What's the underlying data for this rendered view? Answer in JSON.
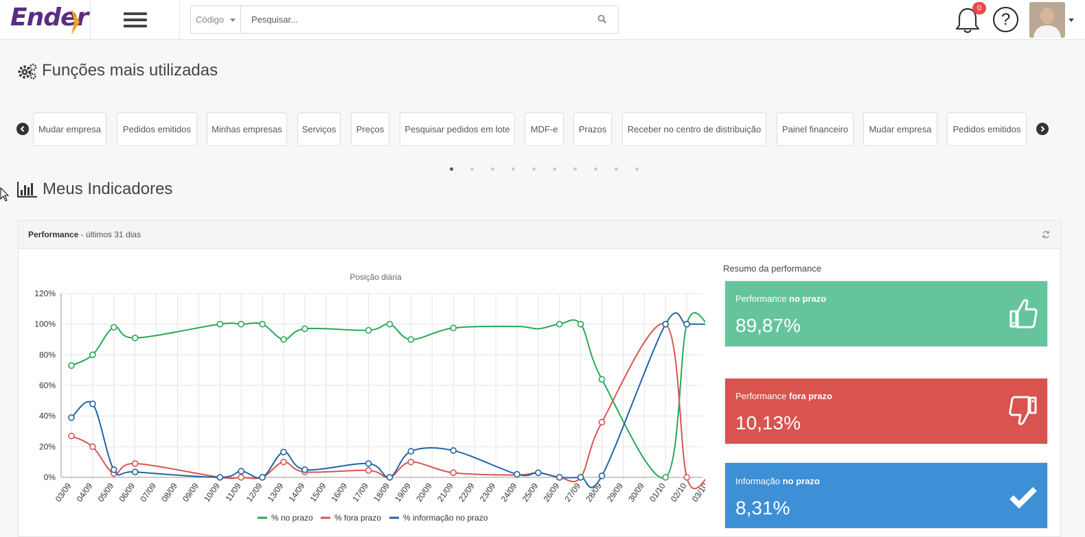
{
  "header": {
    "logo_text": "Ender",
    "search_select": "Código",
    "search_placeholder": "Pesquisar...",
    "notification_count": "0",
    "help_label": "?"
  },
  "funcoes": {
    "title": "Funções mais utilizadas",
    "items": [
      "Mudar empresa",
      "Pedidos emitidos",
      "Minhas empresas",
      "Serviços",
      "Preços",
      "Pesquisar pedidos em lote",
      "MDF-e",
      "Prazos",
      "Receber no centro de distribuição",
      "Painel financeiro",
      "Mudar empresa",
      "Pedidos emitidos"
    ],
    "pages": 10,
    "active_page": 1
  },
  "indicadores": {
    "title": "Meus Indicadores"
  },
  "panel": {
    "title": "Performance",
    "subtitle": " - últimos 31 dias"
  },
  "resumo": {
    "title": "Resumo da performance",
    "cards": [
      {
        "label_pre": "Performance ",
        "label_bold": "no prazo",
        "value": "89,87%",
        "color": "#66c49c",
        "icon": "thumbs-up-icon"
      },
      {
        "label_pre": "Performance ",
        "label_bold": "fora prazo",
        "value": "10,13%",
        "color": "#d9534f",
        "icon": "thumbs-down-icon"
      },
      {
        "label_pre": "Informação ",
        "label_bold": "no prazo",
        "value": "8,31%",
        "color": "#3d8fd6",
        "icon": "check-icon"
      }
    ]
  },
  "chart_data": {
    "type": "line",
    "title": "Posição diária",
    "categories": [
      "03/09",
      "04/09",
      "05/09",
      "06/09",
      "07/09",
      "08/09",
      "09/09",
      "10/09",
      "11/09",
      "12/09",
      "13/09",
      "14/09",
      "15/09",
      "16/09",
      "17/09",
      "18/09",
      "19/09",
      "20/09",
      "21/09",
      "22/09",
      "23/09",
      "24/09",
      "25/09",
      "26/09",
      "27/09",
      "28/09",
      "29/09",
      "30/09",
      "01/10",
      "02/10",
      "03/10"
    ],
    "ylim": [
      0,
      120
    ],
    "yticks": [
      "0%",
      "20%",
      "40%",
      "60%",
      "80%",
      "100%",
      "120%"
    ],
    "grid": true,
    "legend": "bottom",
    "series": [
      {
        "name": "% no prazo",
        "color": "#27a853",
        "values": [
          73,
          80,
          98,
          91,
          null,
          null,
          null,
          100,
          100,
          100,
          90,
          97,
          null,
          null,
          96,
          100,
          90,
          null,
          97.5,
          null,
          null,
          98.5,
          97,
          100,
          100,
          64,
          null,
          null,
          0,
          100,
          100
        ],
        "hollow": [
          true,
          true,
          true,
          true,
          false,
          false,
          false,
          true,
          true,
          true,
          true,
          true,
          false,
          false,
          true,
          true,
          true,
          false,
          true,
          false,
          false,
          false,
          false,
          true,
          true,
          true,
          false,
          false,
          true,
          true,
          false
        ]
      },
      {
        "name": "% fora prazo",
        "color": "#d9534f",
        "values": [
          27,
          20,
          2.5,
          9,
          null,
          null,
          null,
          0,
          0,
          0,
          10,
          3.5,
          null,
          null,
          4.5,
          0,
          10,
          null,
          3,
          null,
          null,
          1.5,
          3,
          0,
          0,
          36,
          null,
          null,
          100,
          0,
          0
        ],
        "hollow": [
          true,
          true,
          true,
          true,
          false,
          false,
          false,
          true,
          true,
          true,
          true,
          true,
          false,
          false,
          true,
          true,
          true,
          false,
          true,
          false,
          false,
          false,
          false,
          true,
          true,
          true,
          false,
          false,
          true,
          true,
          false
        ]
      },
      {
        "name": "% informação no prazo",
        "color": "#2163a0",
        "values": [
          39,
          48,
          5,
          3.5,
          null,
          null,
          null,
          0,
          4,
          0,
          16.5,
          5,
          null,
          null,
          9,
          0,
          17,
          null,
          17.5,
          null,
          null,
          2,
          3,
          0,
          0,
          1,
          null,
          null,
          100,
          100,
          100
        ],
        "hollow": [
          true,
          true,
          true,
          true,
          false,
          false,
          false,
          true,
          true,
          true,
          true,
          true,
          false,
          false,
          true,
          true,
          true,
          false,
          true,
          false,
          false,
          true,
          true,
          true,
          true,
          true,
          false,
          false,
          true,
          true,
          false
        ]
      }
    ]
  }
}
